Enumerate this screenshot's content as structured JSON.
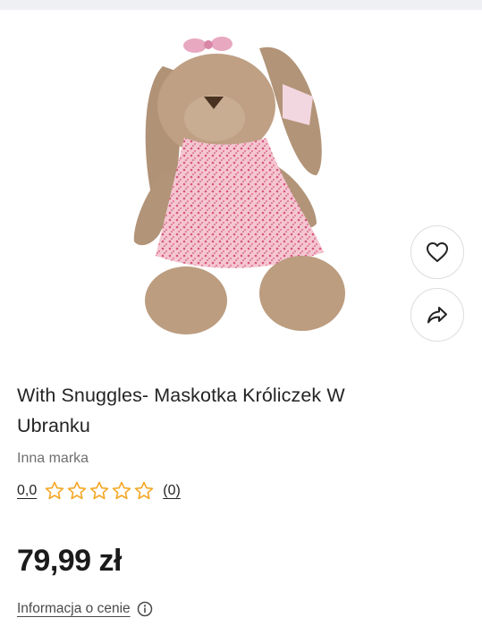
{
  "product": {
    "title": "With Snuggles- Maskotka Króliczek W Ubranku",
    "title_line1": "With Snuggles- Maskotka Króliczek W",
    "title_line2": "Ubranku",
    "brand": "Inna marka",
    "image_subject": "plush bunny toy in pink floral dress"
  },
  "rating": {
    "value": "0,0",
    "stars_filled": 0,
    "stars_total": 5,
    "count": "(0)"
  },
  "price": {
    "amount": "79,99 zł",
    "info_link": "Informacja o cenie"
  },
  "actions": {
    "favorite_icon": "heart-icon",
    "share_icon": "share-arrow-icon"
  },
  "colors": {
    "star_outline": "#f5a623",
    "text_primary": "#242424",
    "text_secondary": "#6f6f6f",
    "top_strip": "#eef0f4"
  }
}
